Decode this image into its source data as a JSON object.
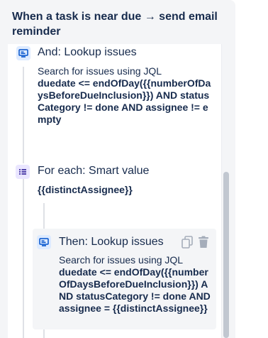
{
  "panel": {
    "title": "When a task is near due → send email reminder"
  },
  "steps": [
    {
      "kind": "action",
      "icon": "lookup-issues-icon",
      "title": "And: Lookup issues",
      "description": "Search for issues using JQL",
      "jql": "duedate <= endOfDay({{numberOfDaysBeforeDueInclusion}}) AND statusCategory != done AND assignee != empty"
    },
    {
      "kind": "branch",
      "icon": "branch-list-icon",
      "title": "For each: Smart value",
      "value": "{{distinctAssignee}}"
    },
    {
      "kind": "action",
      "icon": "lookup-issues-icon",
      "title": "Then: Lookup issues",
      "description": "Search for issues using JQL",
      "jql": "duedate <= endOfDay({{numberOfDaysBeforeDueInclusion}}) AND statusCategory != done AND assignee = {{distinctAssignee}}",
      "actions": [
        "copy-icon",
        "delete-icon"
      ]
    }
  ],
  "colors": {
    "panel_bg": "#f4f5f7",
    "text": "#172b4d",
    "action_icon_bg": "#deebff",
    "action_icon_fg": "#0052cc",
    "branch_icon_bg": "#eae6ff",
    "branch_icon_fg": "#5243aa",
    "connector": "#dfe1e6",
    "tool_icon": "#a5adba"
  }
}
